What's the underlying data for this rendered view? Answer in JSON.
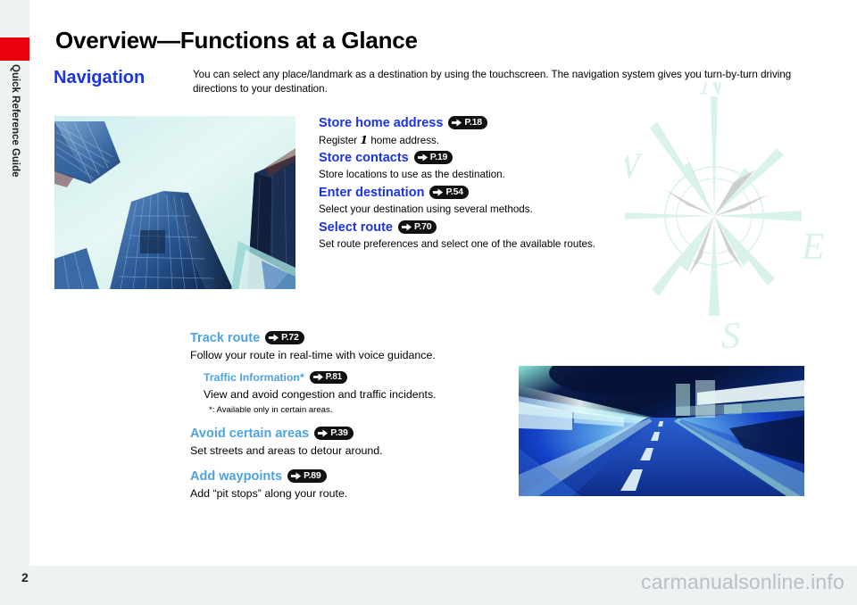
{
  "document": {
    "title": "Overview—Functions at a Glance",
    "section_title": "Navigation",
    "intro": "You can select any place/landmark as a destination by using the touchscreen. The navigation system gives you turn-by-turn driving directions to your destination.",
    "page_number": "2",
    "watermark": "carmanualsonline.info",
    "sidebar_tab": "Quick Reference Guide",
    "sidebar_accent_color": "#e8000d"
  },
  "colors": {
    "heading_blue": "#1a33e6",
    "light_blue": "#4da3e0",
    "pill_background": "#111113",
    "pill_text": "#ffffff",
    "page_background": "#ffffff",
    "outer_background": "#eef2f3",
    "compass_watermark": "#d9f2ec"
  },
  "compass": {
    "north_label": "N",
    "east_label": "E",
    "south_label": "S",
    "west_label": "W"
  },
  "images": {
    "buildings_photo_alt": "skyscrapers-photo",
    "tunnel_photo_alt": "tunnel-road-motion-blur-photo"
  },
  "features_upper": [
    {
      "heading": "Store home address",
      "page_ref": "P.18",
      "desc_pre": "Register ",
      "desc_num": "1",
      "desc_post": " home address."
    },
    {
      "heading": "Store contacts",
      "page_ref": "P.19",
      "desc": "Store locations to use as the destination."
    },
    {
      "heading": "Enter destination",
      "page_ref": "P.54",
      "desc": "Select your destination using several methods."
    },
    {
      "heading": "Select route",
      "page_ref": "P.70",
      "desc": "Set route preferences and select one of the available routes."
    }
  ],
  "features_lower": [
    {
      "heading": "Track route",
      "page_ref": "P.72",
      "desc": "Follow your route in real-time with voice guidance."
    },
    {
      "heading": "Traffic Information*",
      "page_ref": "P.81",
      "desc": "View and avoid congestion and traffic incidents.",
      "note": "*: Available only in certain areas."
    },
    {
      "heading": "Avoid certain areas",
      "page_ref": "P.39",
      "desc": "Set streets and areas to detour around."
    },
    {
      "heading": "Add waypoints",
      "page_ref": "P.89",
      "desc": "Add “pit stops” along your route."
    }
  ]
}
